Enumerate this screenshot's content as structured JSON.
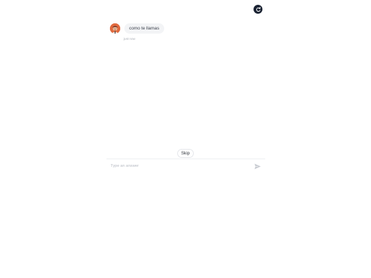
{
  "header": {
    "refresh_icon": "refresh-icon",
    "refresh_color": "#1b2333"
  },
  "chat": {
    "messages": [
      {
        "sender": "bot",
        "avatar_icon": "bot-avatar",
        "text": "como te llamas",
        "timestamp": "just now"
      }
    ]
  },
  "footer": {
    "skip_label": "Skip",
    "input_placeholder": "Type an answer",
    "input_value": "",
    "send_icon": "send-icon"
  },
  "colors": {
    "bubble_bg": "#f3f4f6",
    "avatar_bg": "#e06a3f",
    "divider": "#eef0f2"
  }
}
